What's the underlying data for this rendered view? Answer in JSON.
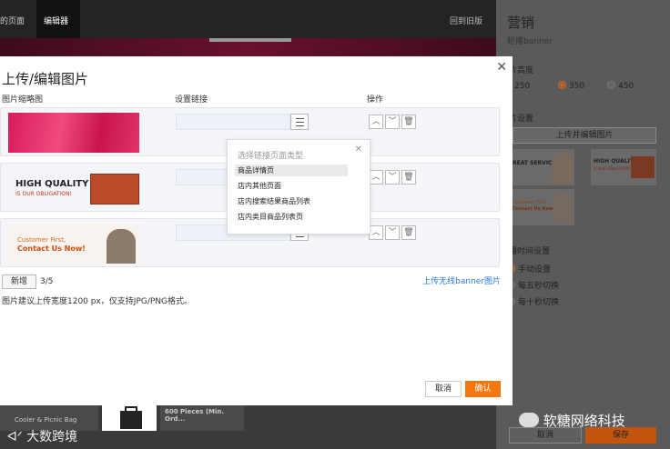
{
  "editor": {
    "tabs": [
      "的页面",
      "编辑器"
    ],
    "back": "回到旧版",
    "bottom_card_1": "Cooler & Picnic Bag",
    "bottom_card_2": "600 Pieces (Min. Ord...",
    "footer_logo": "大数跨境"
  },
  "panel": {
    "title": "营销",
    "subtitle": "轮播banner",
    "height_label": "片高度",
    "heights": [
      "250",
      "350",
      "450"
    ],
    "height_selected": "350",
    "image_label": "片设置",
    "upload_button": "上传并编辑图片",
    "thumbs": [
      {
        "line1": "REAT SERVICE"
      },
      {
        "line1": "HIGH QUALITY",
        "line2": "IS OUR OBLIGATION"
      },
      {
        "line1": "Customer First,",
        "line2": "Contact Us Now!"
      }
    ],
    "interval_label": "播时间设置",
    "interval_options": [
      "手动设置",
      "每五秒切换",
      "每十秒切换"
    ],
    "interval_selected": "手动设置",
    "cancel": "取消",
    "save": "保存",
    "watermark": "软糖网络科技"
  },
  "modal": {
    "title": "上传/编辑图片",
    "col_thumb": "图片缩略图",
    "col_link": "设置链接",
    "col_ops": "操作",
    "rows": [
      {
        "image": "pink-banner"
      },
      {
        "image": "quality-banner",
        "line1": "HIGH QUALITY",
        "line2": "IS OUR OBLIGATION!"
      },
      {
        "image": "service-banner",
        "line1": "Customer First,",
        "line2": "Contact Us Now!"
      }
    ],
    "dropdown": {
      "title": "选择链接页面类型",
      "options": [
        "商品详情页",
        "店内其他页面",
        "店内搜索结果商品列表",
        "店内类目商品列表页"
      ],
      "highlighted": "商品详情页"
    },
    "add_button": "新增",
    "count": "3/5",
    "no_banner_link": "上传无线banner图片",
    "hint": "图片建议上传宽度1200 px，仅支持JPG/PNG格式。",
    "cancel": "取消",
    "confirm": "确认",
    "accent": "#f5780f"
  }
}
